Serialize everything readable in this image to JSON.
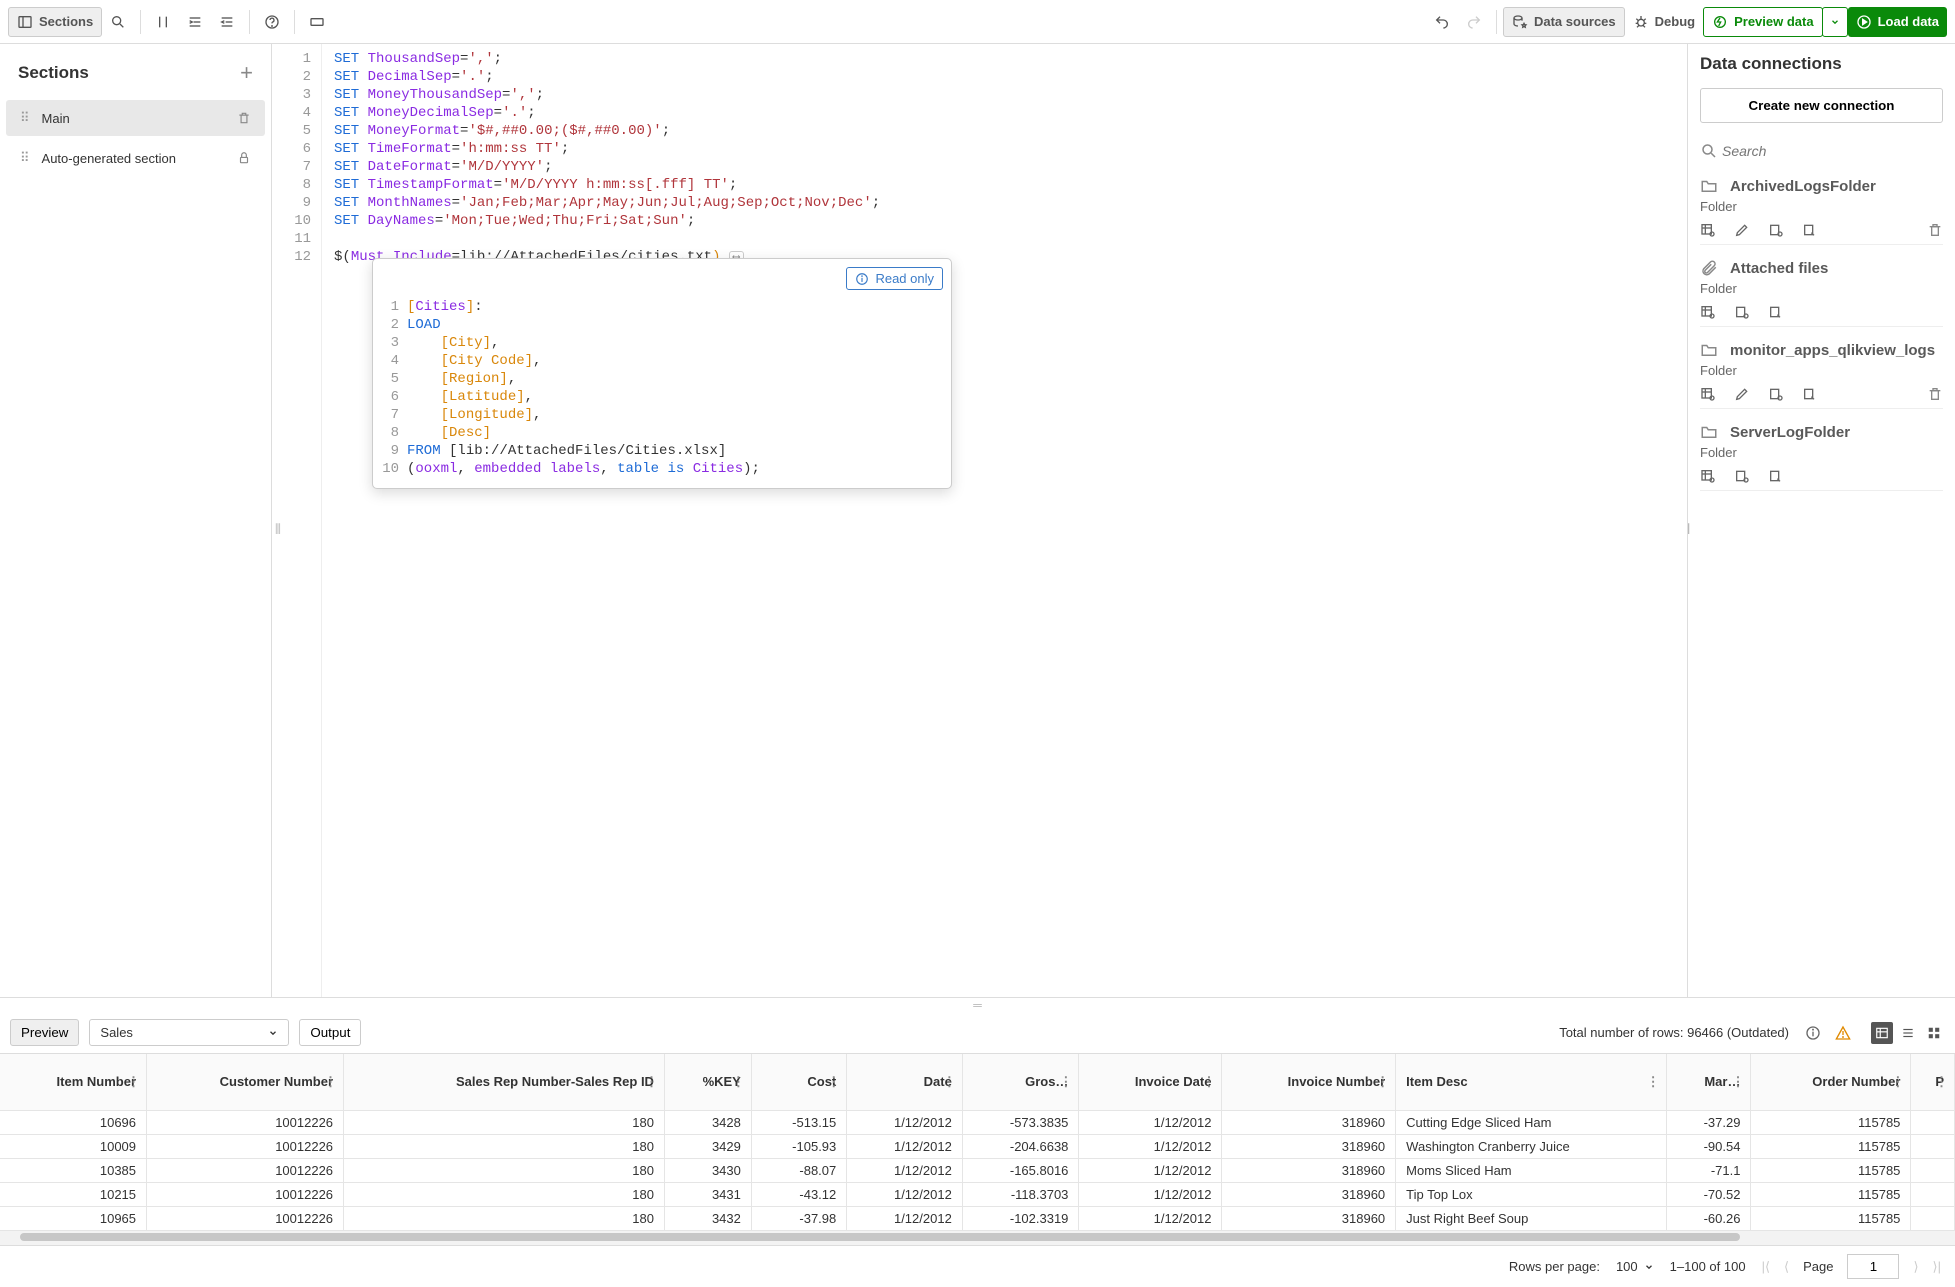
{
  "toolbar": {
    "sections_label": "Sections",
    "data_sources": "Data sources",
    "debug": "Debug",
    "preview_data": "Preview data",
    "load_data": "Load data"
  },
  "sidebar": {
    "title": "Sections",
    "items": [
      {
        "name": "Main",
        "active": true,
        "locked": false
      },
      {
        "name": "Auto-generated section",
        "active": false,
        "locked": true
      }
    ]
  },
  "editor": {
    "lines": [
      "1",
      "2",
      "3",
      "4",
      "5",
      "6",
      "7",
      "8",
      "9",
      "10",
      "11",
      "12"
    ],
    "script": {
      "kw": "SET",
      "vars": [
        "ThousandSep",
        "DecimalSep",
        "MoneyThousandSep",
        "MoneyDecimalSep",
        "MoneyFormat",
        "TimeFormat",
        "DateFormat",
        "TimestampFormat",
        "MonthNames",
        "DayNames"
      ],
      "vals": [
        "','",
        "'.'",
        "','",
        "'.'",
        "'$#,##0.00;($#,##0.00)'",
        "'h:mm:ss TT'",
        "'M/D/YYYY'",
        "'M/D/YYYY h:mm:ss[.fff] TT'",
        "'Jan;Feb;Mar;Apr;May;Jun;Jul;Aug;Sep;Oct;Nov;Dec'",
        "'Mon;Tue;Wed;Thu;Fri;Sat;Sun'"
      ],
      "include": {
        "pre": "$(",
        "var": "Must_Include",
        "eq": "=lib://AttachedFiles/cities.txt",
        "post": ")"
      }
    }
  },
  "popup": {
    "readonly": "Read only",
    "lines": [
      "1",
      "2",
      "3",
      "4",
      "5",
      "6",
      "7",
      "8",
      "9",
      "10"
    ],
    "code": {
      "table_open": "[",
      "table_name": "Cities",
      "table_close": "]",
      "colon": ":",
      "load": "LOAD",
      "fields": [
        "[City]",
        "[City Code]",
        "[Region]",
        "[Latitude]",
        "[Longitude]",
        "[Desc]"
      ],
      "from": "FROM",
      "source": "[lib://AttachedFiles/Cities.xlsx]",
      "opts_open": "(",
      "opts_ooxml": "ooxml",
      "opts_embedded": "embedded labels",
      "opts_tableis": "table is",
      "opts_cities": "Cities",
      "opts_close": ");"
    }
  },
  "connections": {
    "title": "Data connections",
    "create": "Create new connection",
    "search_placeholder": "Search",
    "items": [
      {
        "name": "ArchivedLogsFolder",
        "type": "Folder",
        "has_attach_icon": false,
        "editable": true,
        "deletable": true
      },
      {
        "name": "Attached files",
        "type": "Folder",
        "has_attach_icon": true,
        "editable": false,
        "deletable": false
      },
      {
        "name": "monitor_apps_qlikview_logs",
        "type": "Folder",
        "has_attach_icon": false,
        "editable": true,
        "deletable": true
      },
      {
        "name": "ServerLogFolder",
        "type": "Folder",
        "has_attach_icon": false,
        "editable": false,
        "deletable": false
      }
    ]
  },
  "preview_bar": {
    "preview": "Preview",
    "table_sel": "Sales",
    "output": "Output",
    "rows_info": "Total number of rows: 96466 (Outdated)"
  },
  "table": {
    "headers": [
      "Item Number",
      "Customer Number",
      "Sales Rep Number-Sales Rep ID",
      "%KEY",
      "Cost",
      "Date",
      "Gros…",
      "Invoice Date",
      "Invoice Number",
      "Item Desc",
      "Mar…",
      "Order Number",
      "P"
    ],
    "rows": [
      [
        "10696",
        "10012226",
        "180",
        "3428",
        "-513.15",
        "1/12/2012",
        "-573.3835",
        "1/12/2012",
        "318960",
        "Cutting Edge Sliced Ham",
        "-37.29",
        "115785"
      ],
      [
        "10009",
        "10012226",
        "180",
        "3429",
        "-105.93",
        "1/12/2012",
        "-204.6638",
        "1/12/2012",
        "318960",
        "Washington Cranberry Juice",
        "-90.54",
        "115785"
      ],
      [
        "10385",
        "10012226",
        "180",
        "3430",
        "-88.07",
        "1/12/2012",
        "-165.8016",
        "1/12/2012",
        "318960",
        "Moms Sliced Ham",
        "-71.1",
        "115785"
      ],
      [
        "10215",
        "10012226",
        "180",
        "3431",
        "-43.12",
        "1/12/2012",
        "-118.3703",
        "1/12/2012",
        "318960",
        "Tip Top Lox",
        "-70.52",
        "115785"
      ],
      [
        "10965",
        "10012226",
        "180",
        "3432",
        "-37.98",
        "1/12/2012",
        "-102.3319",
        "1/12/2012",
        "318960",
        "Just Right Beef Soup",
        "-60.26",
        "115785"
      ]
    ]
  },
  "pagination": {
    "rpp_label": "Rows per page:",
    "rpp_value": "100",
    "range": "1–100 of 100",
    "page_label": "Page",
    "page_value": "1"
  }
}
